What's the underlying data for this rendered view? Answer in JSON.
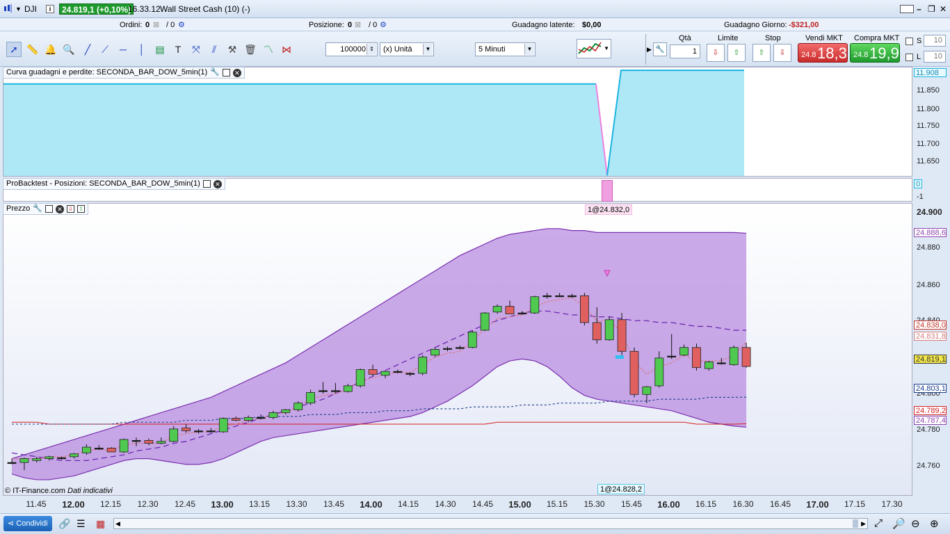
{
  "titlebar": {
    "symbol": "DJI",
    "price_change": "24.819,1 (+0,10%)",
    "time": "16.33.12",
    "instrument": "Wall Street Cash (10) (-)"
  },
  "status": {
    "orders_label": "Ordini:",
    "orders_value": "0",
    "orders_sep": "/ 0",
    "position_label": "Posizione:",
    "position_value": "0",
    "position_sep": "/ 0",
    "latent_label": "Guadagno latente:",
    "latent_value": "$0,00",
    "day_label": "Guadagno Giorno:",
    "day_value": "-$321,00"
  },
  "toolbar": {
    "quantity_value": "100000",
    "unit_value": "(x) Unità",
    "timeframe_value": "5 Minuti",
    "qty_label": "Qtà",
    "qty_value": "1",
    "limit_label": "Limite",
    "stop_label": "Stop",
    "sell_label": "Vendi MKT",
    "sell_small": "24.8",
    "sell_big": "18,3",
    "buy_label": "Compra MKT",
    "buy_small": "24.8",
    "buy_big": "19,9",
    "s_label": "S",
    "s_value": "10",
    "l_label": "L",
    "l_value": "10"
  },
  "panels": {
    "equity_title": "Curva guadagni e perdite: SECONDA_BAR_DOW_5min(1)",
    "positions_title": "ProBacktest - Posizioni: SECONDA_BAR_DOW_5min(1)",
    "price_title": "Prezzo"
  },
  "equity_axis": [
    "11.908",
    "11.850",
    "11.800",
    "11.750",
    "11.700",
    "11.650"
  ],
  "positions_axis": [
    "0",
    "-1"
  ],
  "price_axis": [
    "24.900",
    "24.880",
    "24.860",
    "24.840",
    "24.800",
    "24.780",
    "24.760"
  ],
  "price_boxes": [
    {
      "text": "24.888,6",
      "color": "#8e44ad"
    },
    {
      "text": "24.838,0",
      "color": "#c0392b"
    },
    {
      "text": "24.831,8",
      "color": "#d47a7a"
    },
    {
      "text": "24.819,1",
      "color": "#333333"
    },
    {
      "text": "24.803,1",
      "color": "#1a3c8a"
    },
    {
      "text": "24.789,2",
      "color": "#d62020"
    },
    {
      "text": "24.787,4",
      "color": "#8e44ad"
    }
  ],
  "annotations": {
    "entry": "1@24.832,0",
    "exit": "1@24.828,2"
  },
  "copyright": "© IT-Finance.com",
  "data_note": "Dati indicativi",
  "time_axis": [
    {
      "label": "11.45",
      "bold": false
    },
    {
      "label": "12.00",
      "bold": true
    },
    {
      "label": "12.15",
      "bold": false
    },
    {
      "label": "12.30",
      "bold": false
    },
    {
      "label": "12.45",
      "bold": false
    },
    {
      "label": "13.00",
      "bold": true
    },
    {
      "label": "13.15",
      "bold": false
    },
    {
      "label": "13.30",
      "bold": false
    },
    {
      "label": "13.45",
      "bold": false
    },
    {
      "label": "14.00",
      "bold": true
    },
    {
      "label": "14.15",
      "bold": false
    },
    {
      "label": "14.30",
      "bold": false
    },
    {
      "label": "14.45",
      "bold": false
    },
    {
      "label": "15.00",
      "bold": true
    },
    {
      "label": "15.15",
      "bold": false
    },
    {
      "label": "15.30",
      "bold": false
    },
    {
      "label": "15.45",
      "bold": false
    },
    {
      "label": "16.00",
      "bold": true
    },
    {
      "label": "16.15",
      "bold": false
    },
    {
      "label": "16.30",
      "bold": false
    },
    {
      "label": "16.45",
      "bold": false
    },
    {
      "label": "17.00",
      "bold": true
    },
    {
      "label": "17.15",
      "bold": false
    },
    {
      "label": "17.30",
      "bold": false
    }
  ],
  "bottom": {
    "share_label": "Condividi"
  },
  "colors": {
    "up": "#4fc94f",
    "down": "#e06060",
    "band": "#b98ee0",
    "equity": "#aee8f7"
  },
  "chart_data": {
    "type": "candlestick",
    "interval": "5 Minuti",
    "candles": [
      {
        "o": 24769.0,
        "h": 24771.0,
        "l": 24768.0,
        "c": 24769.0
      },
      {
        "o": 24769.0,
        "h": 24771.5,
        "l": 24765.0,
        "c": 24771.0
      },
      {
        "o": 24770.0,
        "h": 24772.0,
        "l": 24769.0,
        "c": 24771.0
      },
      {
        "o": 24771.0,
        "h": 24772.5,
        "l": 24770.0,
        "c": 24772.0
      },
      {
        "o": 24771.5,
        "h": 24772.0,
        "l": 24770.5,
        "c": 24771.5
      },
      {
        "o": 24772.0,
        "h": 24774.0,
        "l": 24771.0,
        "c": 24773.5
      },
      {
        "o": 24774.0,
        "h": 24778.5,
        "l": 24773.0,
        "c": 24777.0
      },
      {
        "o": 24776.5,
        "h": 24778.0,
        "l": 24775.5,
        "c": 24776.5
      },
      {
        "o": 24776.5,
        "h": 24777.0,
        "l": 24774.5,
        "c": 24774.5
      },
      {
        "o": 24774.5,
        "h": 24781.5,
        "l": 24774.0,
        "c": 24781.0
      },
      {
        "o": 24780.5,
        "h": 24782.0,
        "l": 24777.5,
        "c": 24780.0
      },
      {
        "o": 24780.5,
        "h": 24781.5,
        "l": 24778.0,
        "c": 24779.0
      },
      {
        "o": 24779.0,
        "h": 24782.0,
        "l": 24778.5,
        "c": 24780.0
      },
      {
        "o": 24780.0,
        "h": 24788.0,
        "l": 24779.5,
        "c": 24786.5
      },
      {
        "o": 24787.0,
        "h": 24789.0,
        "l": 24784.5,
        "c": 24785.5
      },
      {
        "o": 24785.5,
        "h": 24786.5,
        "l": 24784.0,
        "c": 24785.5
      },
      {
        "o": 24785.5,
        "h": 24787.0,
        "l": 24784.5,
        "c": 24785.0
      },
      {
        "o": 24785.0,
        "h": 24792.5,
        "l": 24784.5,
        "c": 24792.0
      },
      {
        "o": 24792.0,
        "h": 24793.0,
        "l": 24790.5,
        "c": 24791.0
      },
      {
        "o": 24791.0,
        "h": 24793.5,
        "l": 24790.0,
        "c": 24792.5
      },
      {
        "o": 24792.5,
        "h": 24794.0,
        "l": 24791.5,
        "c": 24792.5
      },
      {
        "o": 24792.5,
        "h": 24796.0,
        "l": 24791.5,
        "c": 24795.0
      },
      {
        "o": 24795.0,
        "h": 24797.0,
        "l": 24794.0,
        "c": 24796.5
      },
      {
        "o": 24796.5,
        "h": 24801.0,
        "l": 24795.5,
        "c": 24800.0
      },
      {
        "o": 24800.0,
        "h": 24807.0,
        "l": 24799.0,
        "c": 24805.5
      },
      {
        "o": 24806.0,
        "h": 24811.0,
        "l": 24805.0,
        "c": 24806.5
      },
      {
        "o": 24806.5,
        "h": 24810.5,
        "l": 24805.0,
        "c": 24806.0
      },
      {
        "o": 24806.0,
        "h": 24810.0,
        "l": 24805.5,
        "c": 24809.0
      },
      {
        "o": 24809.0,
        "h": 24818.0,
        "l": 24808.0,
        "c": 24817.5
      },
      {
        "o": 24817.5,
        "h": 24820.0,
        "l": 24814.0,
        "c": 24815.0
      },
      {
        "o": 24814.5,
        "h": 24817.0,
        "l": 24813.0,
        "c": 24816.5
      },
      {
        "o": 24816.5,
        "h": 24817.5,
        "l": 24815.5,
        "c": 24816.5
      },
      {
        "o": 24815.5,
        "h": 24816.0,
        "l": 24814.0,
        "c": 24815.5
      },
      {
        "o": 24815.5,
        "h": 24825.0,
        "l": 24814.5,
        "c": 24824.0
      },
      {
        "o": 24825.0,
        "h": 24829.0,
        "l": 24824.0,
        "c": 24828.0
      },
      {
        "o": 24828.5,
        "h": 24829.5,
        "l": 24827.0,
        "c": 24828.5
      },
      {
        "o": 24829.0,
        "h": 24830.0,
        "l": 24828.0,
        "c": 24829.0
      },
      {
        "o": 24829.0,
        "h": 24838.0,
        "l": 24828.5,
        "c": 24837.0
      },
      {
        "o": 24838.0,
        "h": 24847.5,
        "l": 24837.5,
        "c": 24847.0
      },
      {
        "o": 24847.5,
        "h": 24851.5,
        "l": 24846.5,
        "c": 24850.5
      },
      {
        "o": 24850.5,
        "h": 24853.5,
        "l": 24849.0,
        "c": 24846.5
      },
      {
        "o": 24846.5,
        "h": 24848.0,
        "l": 24846.0,
        "c": 24847.0
      },
      {
        "o": 24847.0,
        "h": 24856.0,
        "l": 24846.5,
        "c": 24855.5
      },
      {
        "o": 24856.0,
        "h": 24857.5,
        "l": 24854.5,
        "c": 24856.0
      },
      {
        "o": 24856.0,
        "h": 24857.5,
        "l": 24855.5,
        "c": 24856.0
      },
      {
        "o": 24855.5,
        "h": 24857.0,
        "l": 24855.0,
        "c": 24856.0
      },
      {
        "o": 24856.0,
        "h": 24857.5,
        "l": 24840.5,
        "c": 24842.0
      },
      {
        "o": 24842.0,
        "h": 24850.0,
        "l": 24831.0,
        "c": 24833.0
      },
      {
        "o": 24833.0,
        "h": 24845.0,
        "l": 24832.5,
        "c": 24843.5
      },
      {
        "o": 24843.5,
        "h": 24847.0,
        "l": 24825.0,
        "c": 24827.0
      },
      {
        "o": 24827.0,
        "h": 24829.0,
        "l": 24803.0,
        "c": 24804.5
      },
      {
        "o": 24804.5,
        "h": 24809.0,
        "l": 24800.0,
        "c": 24808.5
      },
      {
        "o": 24809.0,
        "h": 24827.0,
        "l": 24808.0,
        "c": 24823.5
      },
      {
        "o": 24824.0,
        "h": 24836.0,
        "l": 24823.0,
        "c": 24824.5
      },
      {
        "o": 24825.0,
        "h": 24830.5,
        "l": 24824.5,
        "c": 24829.0
      },
      {
        "o": 24829.0,
        "h": 24831.0,
        "l": 24817.0,
        "c": 24818.5
      },
      {
        "o": 24818.0,
        "h": 24822.0,
        "l": 24817.0,
        "c": 24821.5
      },
      {
        "o": 24821.0,
        "h": 24823.5,
        "l": 24820.0,
        "c": 24821.0
      },
      {
        "o": 24820.0,
        "h": 24830.0,
        "l": 24819.5,
        "c": 24829.0
      },
      {
        "o": 24829.0,
        "h": 24831.5,
        "l": 24818.5,
        "c": 24819.1
      }
    ],
    "bollinger_upper": [
      24771,
      24773,
      24775,
      24777,
      24779,
      24781,
      24783,
      24785,
      24787,
      24789,
      24791,
      24793,
      24795,
      24797,
      24799,
      24801,
      24803,
      24806,
      24809,
      24812,
      24815,
      24818,
      24821,
      24825,
      24829,
      24833,
      24837,
      24841,
      24845,
      24849,
      24853,
      24857,
      24861,
      24865,
      24869,
      24873,
      24877,
      24880,
      24883,
      24886,
      24888,
      24889,
      24890,
      24891,
      24891,
      24890,
      24890,
      24889,
      24889,
      24889,
      24889,
      24889,
      24889,
      24889,
      24889,
      24889,
      24889,
      24889,
      24889,
      24888.6
    ],
    "bollinger_lower": [
      24763,
      24761,
      24760,
      24760,
      24761,
      24762,
      24764,
      24766,
      24768,
      24770,
      24771,
      24771,
      24770,
      24769,
      24768,
      24768,
      24769,
      24771,
      24774,
      24777,
      24780,
      24782,
      24783,
      24784,
      24785,
      24786,
      24787,
      24788,
      24789,
      24790,
      24791,
      24792,
      24793,
      24795,
      24798,
      24801,
      24805,
      24809,
      24814,
      24819,
      24822,
      24823,
      24822,
      24819,
      24814,
      24808,
      24804,
      24802,
      24801,
      24800,
      24799,
      24798,
      24797,
      24796,
      24794,
      24792,
      24790,
      24789,
      24788,
      24787.4
    ],
    "bollinger_mid": [
      24774,
      24773,
      24772,
      24771,
      24770,
      24770,
      24770,
      24771,
      24772,
      24773,
      24775,
      24776,
      24777,
      24779,
      24780,
      24782,
      24784,
      24786,
      24788,
      24790,
      24792,
      24794,
      24796,
      24798,
      24800,
      24802,
      24805,
      24808,
      24811,
      24814,
      24817,
      24820,
      24823,
      24826,
      24829,
      24832,
      24835,
      24838,
      24841,
      24843,
      24845,
      24847,
      24848,
      24848,
      24847,
      24846,
      24846,
      24845,
      24845,
      24844,
      24843,
      24843,
      24842,
      24842,
      24841,
      24840,
      24840,
      24839,
      24838,
      24838.0
    ],
    "ema_fast": [
      24771,
      24771,
      24771,
      24772,
      24772,
      24773,
      24775,
      24776,
      24775,
      24778,
      24779,
      24779,
      24779,
      24783,
      24784,
      24785,
      24785,
      24788,
      24789,
      24791,
      24792,
      24794,
      24795,
      24798,
      24802,
      24804,
      24805,
      24807,
      24812,
      24813,
      24815,
      24816,
      24816,
      24820,
      24824,
      24826,
      24827,
      24832,
      24839,
      24844,
      24845,
      24846,
      24850,
      24853,
      24854,
      24855,
      24850,
      24843,
      24843,
      24837,
      24822,
      24815,
      24819,
      24821,
      24825,
      24822,
      24822,
      24822,
      24825,
      24831.8
    ],
    "sma_slow": [
      24790,
      24790,
      24790,
      24789,
      24789,
      24789,
      24789,
      24789,
      24789,
      24789,
      24789,
      24789,
      24789,
      24789,
      24789,
      24789,
      24789,
      24789,
      24789,
      24789,
      24789,
      24789,
      24789,
      24789,
      24789,
      24789,
      24789,
      24789,
      24789,
      24789,
      24789,
      24789,
      24789,
      24789,
      24789,
      24789,
      24789,
      24789,
      24789,
      24790,
      24790,
      24790,
      24790,
      24790,
      24790,
      24790,
      24790,
      24790,
      24790,
      24790,
      24790,
      24790,
      24790,
      24790,
      24790,
      24789,
      24789,
      24789,
      24789,
      24789.2
    ],
    "ma_dotted": [
      24789,
      24789,
      24789,
      24789,
      24789,
      24789,
      24789,
      24789,
      24789,
      24790,
      24790,
      24790,
      24790,
      24790,
      24791,
      24791,
      24791,
      24792,
      24792,
      24792,
      24793,
      24793,
      24793,
      24793,
      24794,
      24794,
      24794,
      24795,
      24795,
      24795,
      24796,
      24796,
      24796,
      24797,
      24797,
      24797,
      24797,
      24798,
      24798,
      24798,
      24798,
      24799,
      24799,
      24799,
      24800,
      24800,
      24800,
      24800,
      24801,
      24801,
      24801,
      24801,
      24802,
      24802,
      24802,
      24802,
      24803,
      24803,
      24803,
      24803.1
    ],
    "equity_curve": {
      "start": 11872,
      "min": 11630,
      "end": 11908
    },
    "y_range": [
      24752,
      24904
    ]
  }
}
